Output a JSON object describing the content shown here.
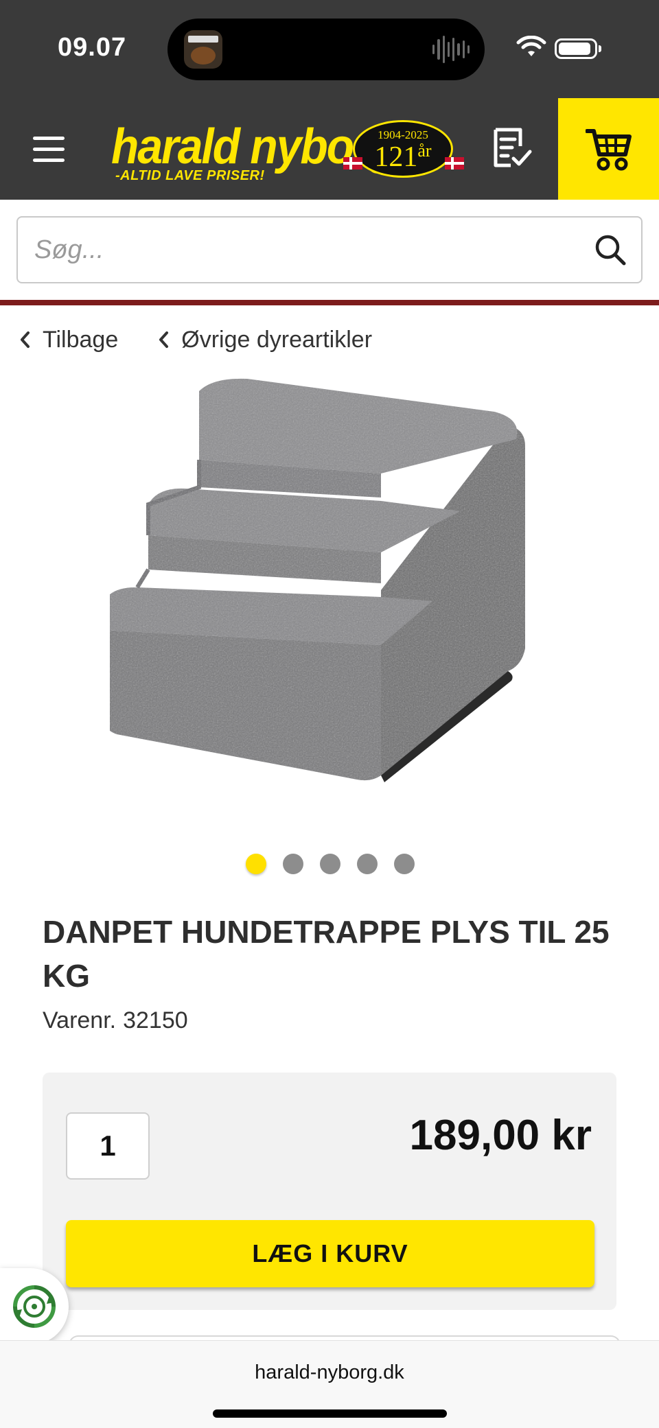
{
  "status_bar": {
    "time": "09.07"
  },
  "header": {
    "logo_text": "harald nyborg",
    "logo_tagline": "-ALTID LAVE PRISER!",
    "anniversary_years": "1904-2025",
    "anniversary_count": "121",
    "anniversary_unit": "år",
    "brand_color": "#ffe600",
    "header_bg": "#3a3a3a",
    "icons": [
      "hamburger-menu-icon",
      "shopping-list-icon",
      "cart-icon"
    ]
  },
  "search": {
    "placeholder": "Søg...",
    "value": ""
  },
  "breadcrumbs": [
    {
      "label": "Tilbage"
    },
    {
      "label": "Øvrige dyreartikler"
    }
  ],
  "gallery": {
    "image_count": 5,
    "active_index": 0
  },
  "product": {
    "title": "DANPET HUNDETRAPPE PLYS TIL 25 KG",
    "sku_label": "Varenr.",
    "sku_value": "32150",
    "quantity": "1",
    "price": "189,00 kr",
    "add_to_cart_label": "LÆG I KURV"
  },
  "browser": {
    "url": "harald-nyborg.dk"
  }
}
